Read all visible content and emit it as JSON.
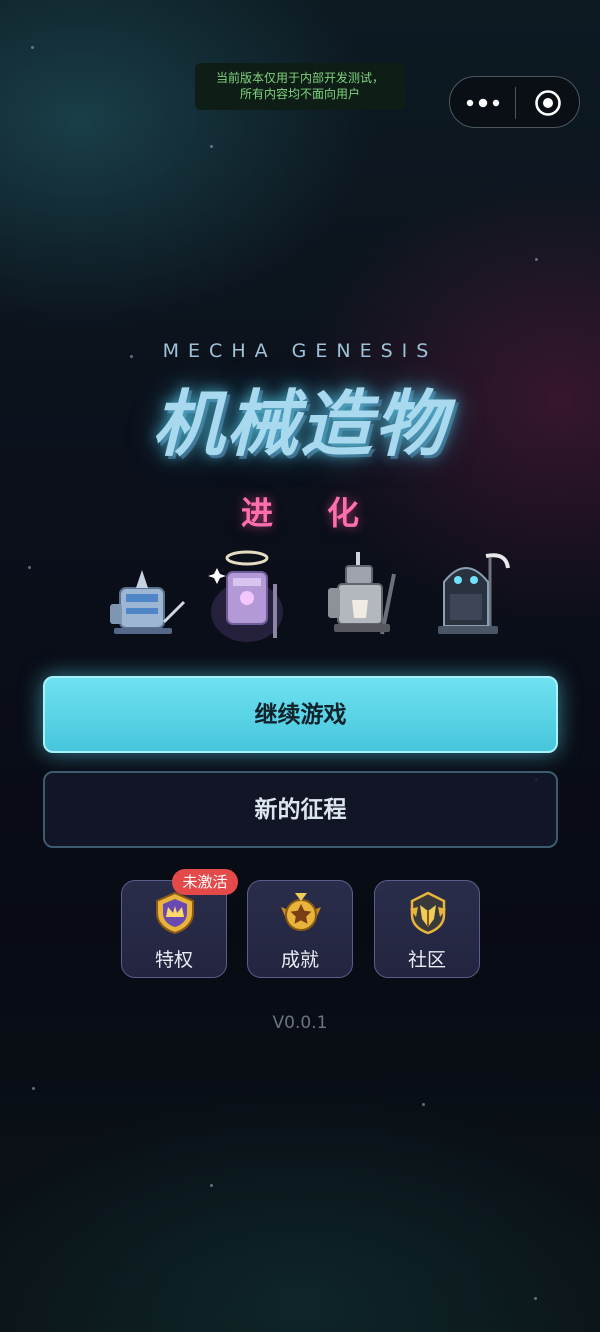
{
  "notice": {
    "line1": "当前版本仅用于内部开发测试，",
    "line2": "所有内容均不面向用户"
  },
  "capsule": {
    "more_icon": "more-dots-icon",
    "close_icon": "target-circle-icon"
  },
  "game": {
    "subtitle": "MECHA GENESIS",
    "title": "机械造物",
    "mode": "进化"
  },
  "mechas": [
    {
      "name": "knight-mecha-icon",
      "color": "#a8c8e8"
    },
    {
      "name": "angel-mecha-icon",
      "color": "#c6a6e6"
    },
    {
      "name": "paladin-mecha-icon",
      "color": "#b8bcc4"
    },
    {
      "name": "reaper-mecha-icon",
      "color": "#8aa0b4"
    }
  ],
  "buttons": {
    "continue": "继续游戏",
    "new_journey": "新的征程"
  },
  "tiles": [
    {
      "label": "特权",
      "icon": "crown-shield-icon"
    },
    {
      "label": "成就",
      "icon": "star-medal-icon"
    },
    {
      "label": "社区",
      "icon": "community-crest-icon"
    }
  ],
  "privilege_badge": "未激活",
  "version": "V0.0.1",
  "colors": {
    "accent": "#5fd6ea",
    "badge": "#e54a4a",
    "pink": "#ff6fae"
  }
}
